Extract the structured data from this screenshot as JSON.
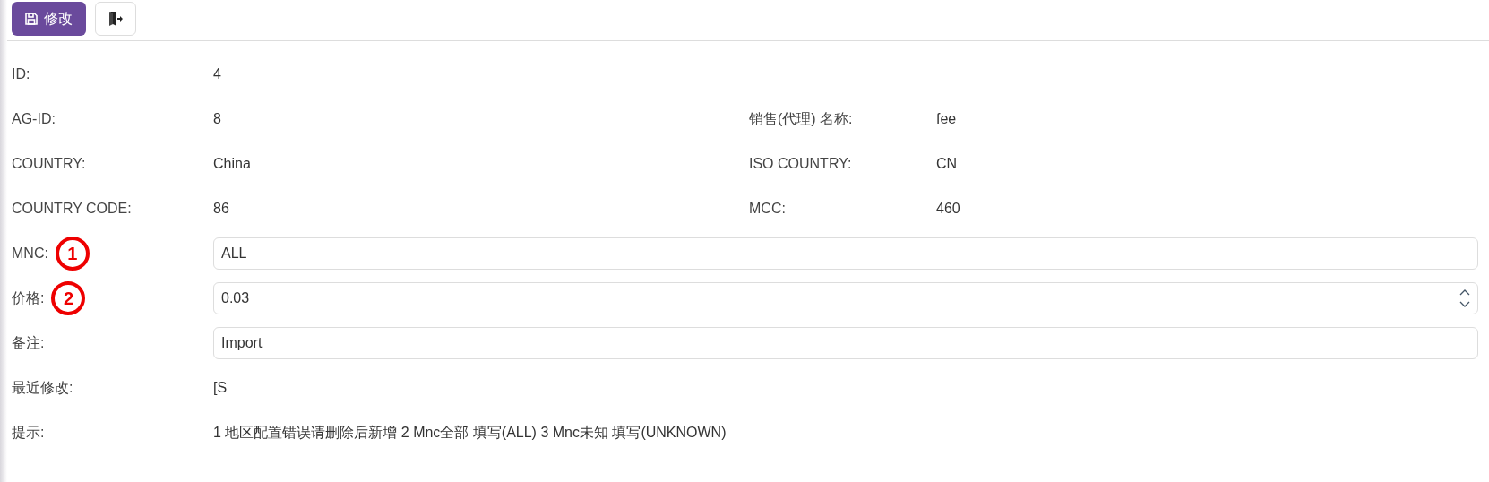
{
  "toolbar": {
    "save_button": {
      "label": "修改"
    }
  },
  "rows": [
    {
      "kind": "text",
      "label": "ID:",
      "value": "4"
    },
    {
      "kind": "text",
      "label": "AG-ID:",
      "value": "8",
      "right": {
        "label": "销售(代理) 名称:",
        "value": "fee"
      }
    },
    {
      "kind": "text",
      "label": "COUNTRY:",
      "value": "China",
      "right": {
        "label": "ISO COUNTRY:",
        "value": "CN"
      }
    },
    {
      "kind": "text",
      "label": "COUNTRY CODE:",
      "value": "86",
      "right": {
        "label": "MCC:",
        "value": "460"
      }
    },
    {
      "kind": "input",
      "label": "MNC:",
      "value": "ALL",
      "marker": "1"
    },
    {
      "kind": "number",
      "label": "价格:",
      "value": "0.03",
      "marker": "2"
    },
    {
      "kind": "input",
      "label": "备注:",
      "value": "Import"
    },
    {
      "kind": "text",
      "label": "最近修改:",
      "value": "[S"
    },
    {
      "kind": "text",
      "label": "提示:",
      "value": "1 地区配置错误请删除后新增 2 Mnc全部 填写(ALL) 3 Mnc未知 填写(UNKNOWN)"
    }
  ]
}
